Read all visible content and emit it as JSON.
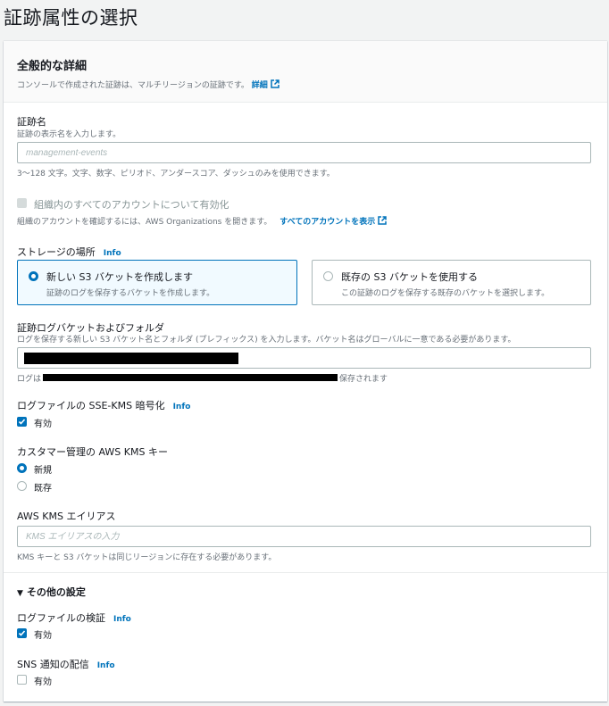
{
  "page": {
    "title": "証跡属性の選択"
  },
  "general": {
    "title": "全般的な詳細",
    "description": "コンソールで作成された証跡は、マルチリージョンの証跡です。",
    "details_link": "詳細"
  },
  "trail_name": {
    "label": "証跡名",
    "description": "証跡の表示名を入力します。",
    "placeholder": "management-events",
    "constraint": "3～128 文字。文字、数字、ピリオド、アンダースコア、ダッシュのみを使用できます。"
  },
  "organization": {
    "checkbox_label": "組織内のすべてのアカウントについて有効化",
    "description": "組織のアカウントを確認するには、AWS Organizations を開きます。",
    "link": "すべてのアカウントを表示"
  },
  "storage": {
    "label": "ストレージの場所",
    "info": "Info",
    "new_title": "新しい S3 バケットを作成します",
    "new_desc": "証跡のログを保存するバケットを作成します。",
    "existing_title": "既存の S3 バケットを使用する",
    "existing_desc": "この証跡のログを保存する既存のバケットを選択します。"
  },
  "bucket": {
    "label": "証跡ログバケットおよびフォルダ",
    "description": "ログを保存する新しい S3 バケット名とフォルダ (プレフィックス) を入力します。バケット名はグローバルに一意である必要があります。",
    "log_prefix": "ログは",
    "log_suffix": "保存されます"
  },
  "sse_kms": {
    "label": "ログファイルの SSE-KMS 暗号化",
    "info": "Info",
    "checkbox_label": "有効",
    "checked": true
  },
  "kms_key": {
    "label": "カスタマー管理の AWS KMS キー",
    "option_new": "新規",
    "option_existing": "既存"
  },
  "kms_alias": {
    "label": "AWS KMS エイリアス",
    "placeholder": "KMS エイリアスの入力",
    "constraint": "KMS キーと S3 バケットは同じリージョンに存在する必要があります。"
  },
  "additional": {
    "toggle_label": "その他の設定",
    "validation_label": "ログファイルの検証",
    "validation_info": "Info",
    "validation_checkbox": "有効",
    "sns_label": "SNS 通知の配信",
    "sns_info": "Info",
    "sns_checkbox": "有効"
  },
  "colors": {
    "accent": "#0073bb",
    "border": "#aab7b8",
    "muted": "#687078"
  }
}
